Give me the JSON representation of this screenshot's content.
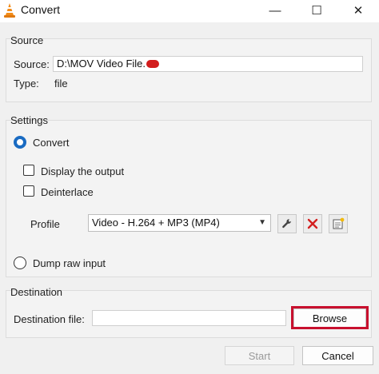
{
  "window": {
    "title": "Convert",
    "controls": {
      "minimize": "—",
      "maximize": "☐",
      "close": "✕"
    }
  },
  "source": {
    "group_title": "Source",
    "source_label": "Source:",
    "source_value": "D:\\MOV Video File.",
    "type_label": "Type:",
    "type_value": "file"
  },
  "settings": {
    "group_title": "Settings",
    "convert_label": "Convert",
    "convert_selected": true,
    "display_output_label": "Display the output",
    "display_output_checked": false,
    "deinterlace_label": "Deinterlace",
    "deinterlace_checked": false,
    "profile_label": "Profile",
    "profile_value": "Video - H.264 + MP3 (MP4)",
    "dump_raw_label": "Dump raw input",
    "dump_raw_selected": false,
    "tools": [
      "wrench-icon",
      "delete-icon",
      "new-profile-icon"
    ]
  },
  "destination": {
    "group_title": "Destination",
    "dest_label": "Destination file:",
    "dest_value": "",
    "browse_label": "Browse"
  },
  "footer": {
    "start_label": "Start",
    "cancel_label": "Cancel"
  },
  "colors": {
    "accent": "#1a6bc2",
    "highlight": "#c8102e",
    "delete_red": "#d32020",
    "vlc_orange": "#f28c1a"
  }
}
